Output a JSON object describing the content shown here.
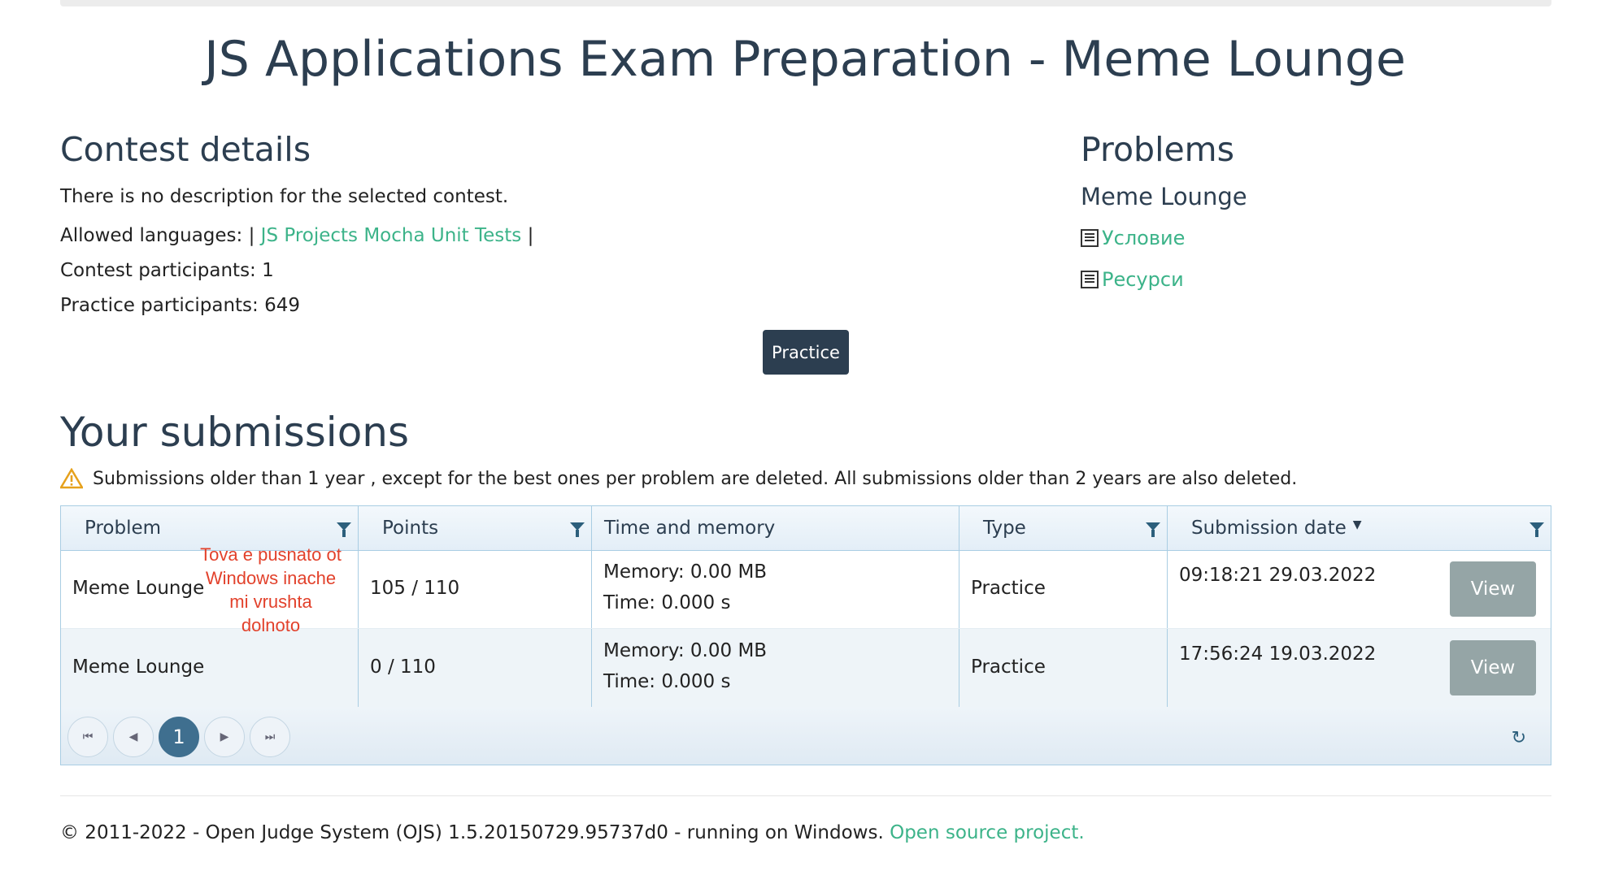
{
  "title": "JS Applications Exam Preparation - Meme Lounge",
  "contest": {
    "heading": "Contest details",
    "description": "There is no description for the selected contest.",
    "allowed_prefix": "Allowed languages: |",
    "allowed_language": "JS Projects Mocha Unit Tests",
    "allowed_suffix": "|",
    "contest_participants": "Contest participants: 1",
    "practice_participants": "Practice participants: 649"
  },
  "problems": {
    "heading": "Problems",
    "name": "Meme Lounge",
    "links": [
      "Условие",
      "Ресурси"
    ],
    "link_icon": "document-list-icon"
  },
  "practice_button": "Practice",
  "submissions": {
    "heading": "Your submissions",
    "warning_icon": "warning-triangle-icon",
    "warning": "Submissions older than 1 year , except for the best ones per problem are deleted. All submissions older than 2 years are also deleted.",
    "columns": [
      "Problem",
      "Points",
      "Time and memory",
      "Type",
      "Submission date"
    ],
    "sort_indicator": "▼",
    "rows": [
      {
        "problem": "Meme Lounge",
        "points": "105 / 110",
        "memory": "Memory: 0.00 MB",
        "time": "Time: 0.000 s",
        "type": "Practice",
        "date": "09:18:21 29.03.2022",
        "action": "View"
      },
      {
        "problem": "Meme Lounge",
        "points": "0 / 110",
        "memory": "Memory: 0.00 MB",
        "time": "Time: 0.000 s",
        "type": "Practice",
        "date": "17:56:24 19.03.2022",
        "action": "View"
      }
    ],
    "annotation_lines": [
      "Tova e pusnato ot",
      "Windows inache",
      "mi vrushta",
      "dolnoto"
    ],
    "pager": {
      "first": "⏮",
      "prev": "◀",
      "current": "1",
      "next": "▶",
      "last": "⏭",
      "refresh": "↻"
    }
  },
  "footer": {
    "text": "© 2011-2022 - Open Judge System (OJS) 1.5.20150729.95737d0 - running on Windows.",
    "link": "Open source project."
  },
  "colors": {
    "accent": "#3cb389",
    "primary": "#2c3e50",
    "annotation": "#e2412b",
    "view_button": "#95a5a6"
  }
}
